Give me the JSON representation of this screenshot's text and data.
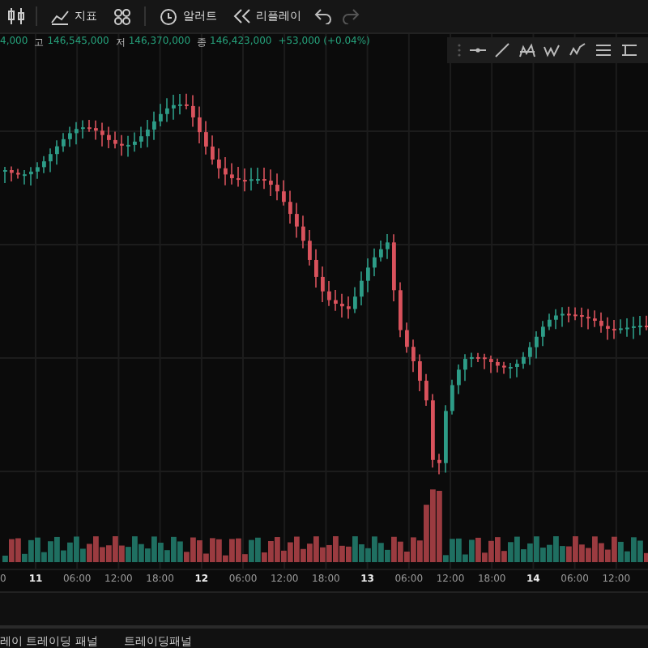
{
  "toolbar": {
    "buttons": [
      {
        "kind": "indicators",
        "label": "지표"
      },
      {
        "kind": "layout"
      },
      {
        "kind": "alert",
        "label": "알러트"
      },
      {
        "kind": "replay",
        "label": "리플레이"
      }
    ],
    "history": [
      {
        "kind": "undo",
        "disabled": false
      },
      {
        "kind": "redo",
        "disabled": true
      }
    ]
  },
  "ohlc": {
    "open": "4,000",
    "high_label": "고",
    "high": "146,545,000",
    "low_label": "저",
    "low": "146,370,000",
    "close_label": "종",
    "close": "146,423,000",
    "change": "+53,000 (+0.04%)"
  },
  "x_axis": [
    {
      "label": "0",
      "major": false
    },
    {
      "label": "11",
      "major": true
    },
    {
      "label": "06:00",
      "major": false
    },
    {
      "label": "12:00",
      "major": false
    },
    {
      "label": "18:00",
      "major": false
    },
    {
      "label": "12",
      "major": true
    },
    {
      "label": "06:00",
      "major": false
    },
    {
      "label": "12:00",
      "major": false
    },
    {
      "label": "18:00",
      "major": false
    },
    {
      "label": "13",
      "major": true
    },
    {
      "label": "06:00",
      "major": false
    },
    {
      "label": "12:00",
      "major": false
    },
    {
      "label": "18:00",
      "major": false
    },
    {
      "label": "14",
      "major": true
    },
    {
      "label": "06:00",
      "major": false
    },
    {
      "label": "12:00",
      "major": false
    }
  ],
  "bottom_tabs": [
    {
      "label": "레이 트레이딩 패널"
    },
    {
      "label": "트레이딩패널"
    }
  ]
}
